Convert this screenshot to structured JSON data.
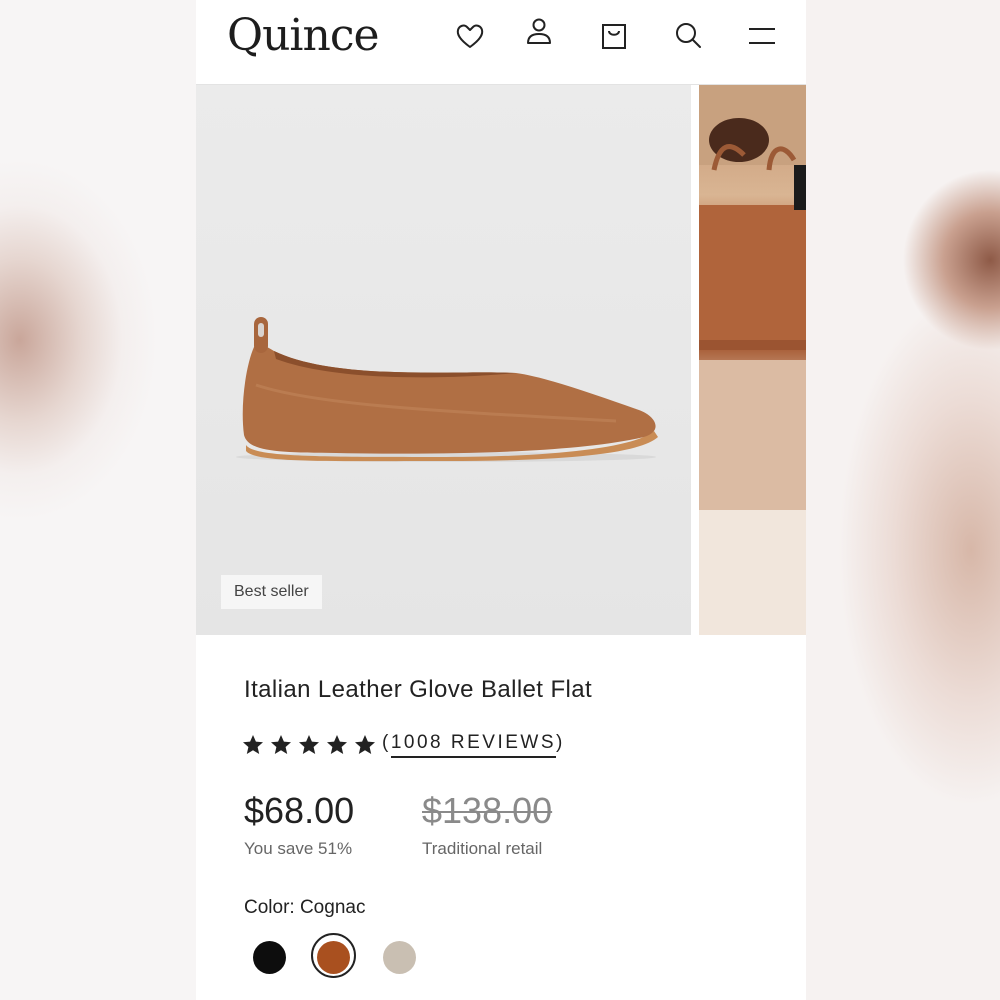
{
  "header": {
    "logo": "Quince",
    "icons": [
      "heart-icon",
      "user-icon",
      "bag-icon",
      "search-icon",
      "menu-icon"
    ]
  },
  "gallery": {
    "badge": "Best seller"
  },
  "product": {
    "title": "Italian Leather Glove Ballet Flat",
    "rating": 5,
    "reviews_open": "(",
    "reviews_text": "1008 REVIEWS",
    "reviews_close": ")",
    "price": "$68.00",
    "savings": "You save 51%",
    "original_price": "$138.00",
    "original_label": "Traditional retail",
    "color_label": "Color: Cognac",
    "swatches": [
      {
        "name": "Black",
        "color": "#0d0d0d",
        "selected": false
      },
      {
        "name": "Cognac",
        "color": "#a9501f",
        "selected": true
      },
      {
        "name": "Taupe",
        "color": "#c9bfb2",
        "selected": false
      }
    ]
  },
  "colors": {
    "leather": "#b06f44",
    "sole": "#c98c55"
  }
}
